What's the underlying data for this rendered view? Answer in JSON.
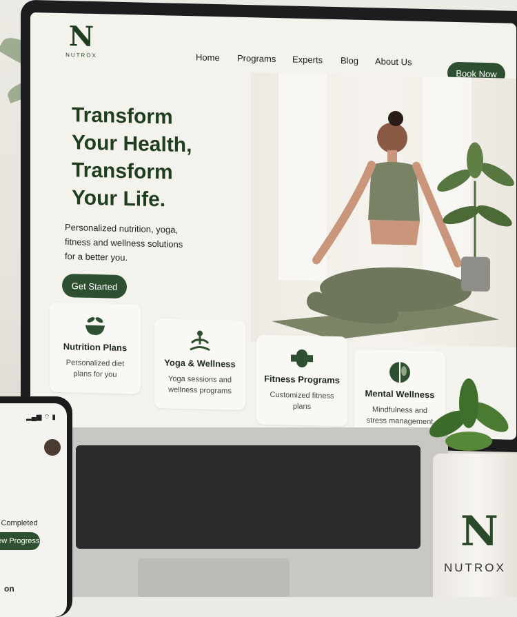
{
  "brand": {
    "logo_mark": "N",
    "name": "NUTROX"
  },
  "nav": {
    "links": [
      "Home",
      "Programs",
      "Experts",
      "Blog",
      "About Us"
    ],
    "book_button": "Book Now"
  },
  "hero": {
    "title_lines": [
      "Transform",
      "Your Health,",
      "Transform",
      "Your Life."
    ],
    "subtitle_lines": [
      "Personalized nutrition, yoga,",
      "fitness and wellness solutions",
      "for a better you."
    ],
    "cta": "Get Started"
  },
  "cards": [
    {
      "title": "Nutrition Plans",
      "desc": "Personalized diet plans for you",
      "icon": "bowl-icon"
    },
    {
      "title": "Yoga & Wellness",
      "desc": "Yoga sessions and wellness programs",
      "icon": "meditation-icon"
    },
    {
      "title": "Fitness Programs",
      "desc": "Customized fitness plans",
      "icon": "fitness-icon"
    },
    {
      "title": "Mental Wellness",
      "desc": "Mindfulness and stress management",
      "icon": "brain-icon"
    }
  ],
  "phone": {
    "status_text": "l Completed",
    "progress_button": "View Progress",
    "bottom_text": "on"
  },
  "pot": {
    "logo_mark": "N",
    "name": "NUTROX"
  },
  "colors": {
    "brand_green": "#2f5030",
    "text_green": "#1f3d1f"
  }
}
